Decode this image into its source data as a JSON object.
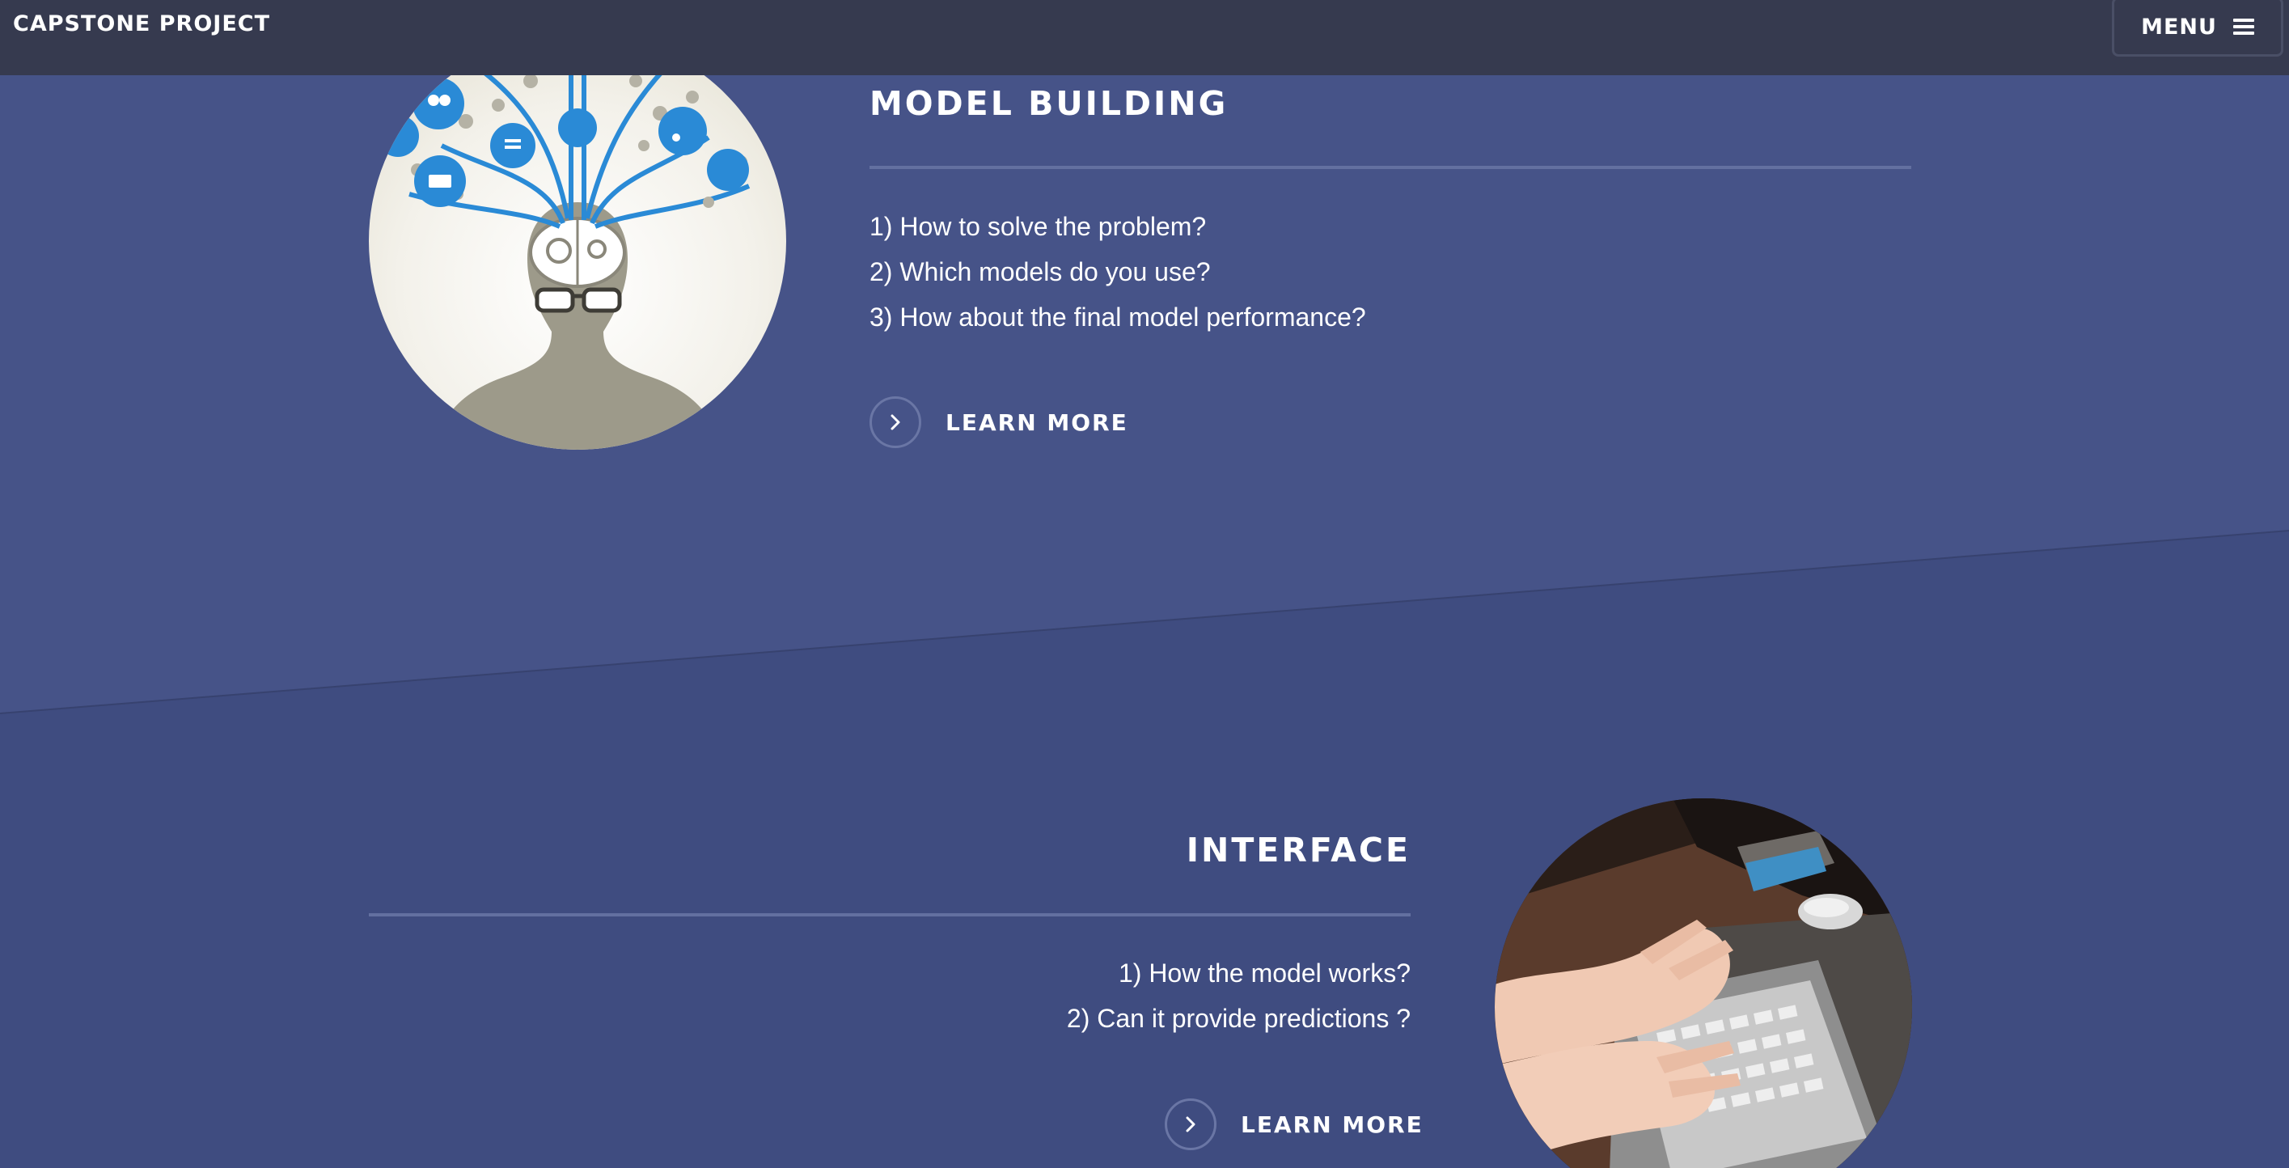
{
  "navbar": {
    "brand": "CAPSTONE PROJECT",
    "menu_label": "MENU"
  },
  "sections": [
    {
      "title": "MODEL BUILDING",
      "lines": [
        "1) How to solve the problem?",
        "2) Which models do you use?",
        "3) How about the final model performance?"
      ],
      "cta": "LEARN MORE",
      "image_alt": "brain-network-illustration"
    },
    {
      "title": "INTERFACE",
      "lines": [
        "1) How the model works?",
        "2) Can it provide predictions ?"
      ],
      "cta": "LEARN MORE",
      "image_alt": "hands-typing-on-laptop-photo"
    }
  ],
  "colors": {
    "nav_bg": "#363a4f",
    "section_upper_bg": "#465388",
    "section_lower_bg": "#3f4c80",
    "divider": "#6370a0",
    "text": "#ffffff",
    "icon_blue": "#2a8ad6"
  },
  "icons": {
    "menu": "hamburger-icon",
    "cta": "chevron-right-icon"
  }
}
